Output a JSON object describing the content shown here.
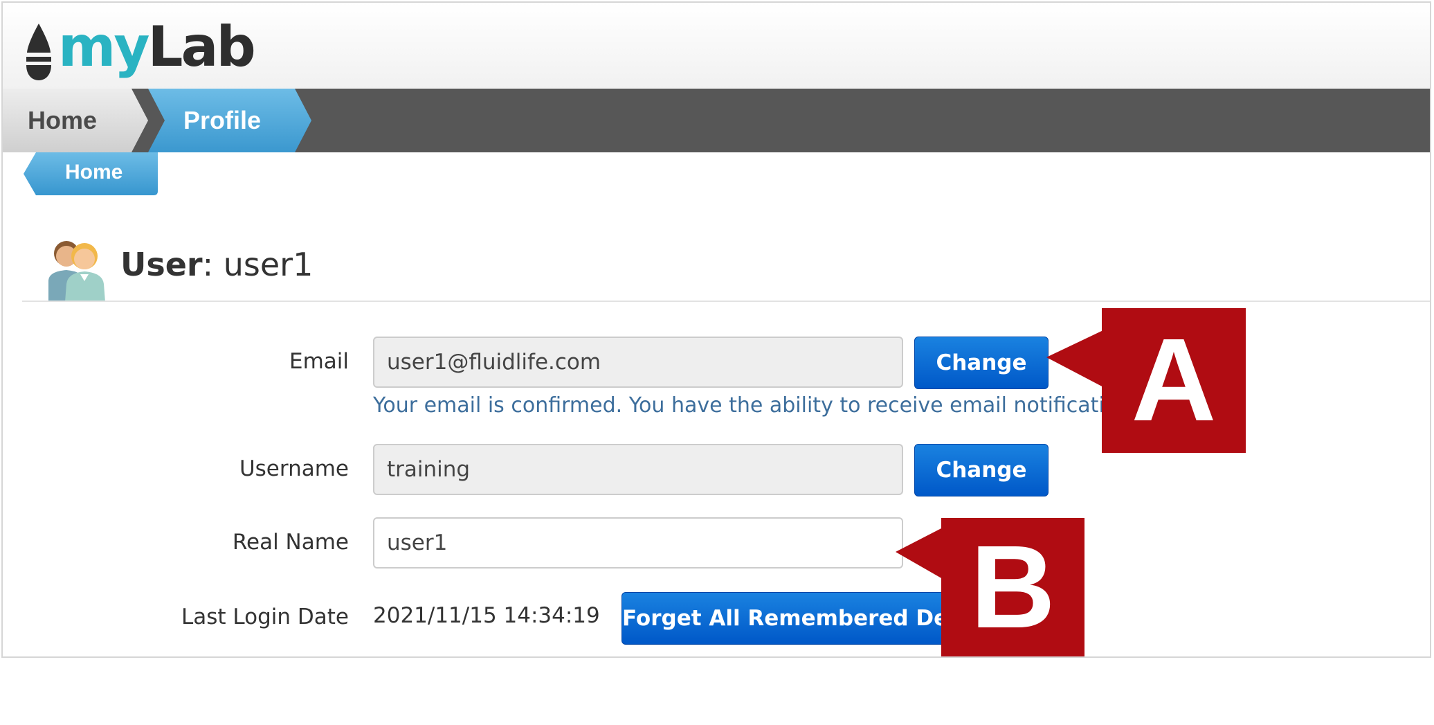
{
  "app": {
    "logo_my": "my",
    "logo_lab": "Lab"
  },
  "nav": {
    "home_label": "Home",
    "profile_label": "Profile",
    "back_label": "Home"
  },
  "user": {
    "title_key": "User",
    "title_sep": ": ",
    "title_value": "user1"
  },
  "form": {
    "email_label": "Email",
    "email_value": "user1@fluidlife.com",
    "email_change_label": "Change",
    "email_help": "Your email is confirmed. You have the ability to receive email notifications.",
    "username_label": "Username",
    "username_value": "training",
    "username_change_label": "Change",
    "realname_label": "Real Name",
    "realname_value": "user1",
    "last_login_label": "Last Login Date",
    "last_login_value": "2021/11/15 14:34:19",
    "forget_devices_label": "Forget All Remembered Devices"
  },
  "callouts": {
    "a": "A",
    "b": "B"
  },
  "colors": {
    "nav_bar": "#575757",
    "nav_active": "#4aa3d6",
    "button_blue": "#0066d6",
    "callout_red": "#b00c12",
    "help_text": "#3d6e9c"
  }
}
